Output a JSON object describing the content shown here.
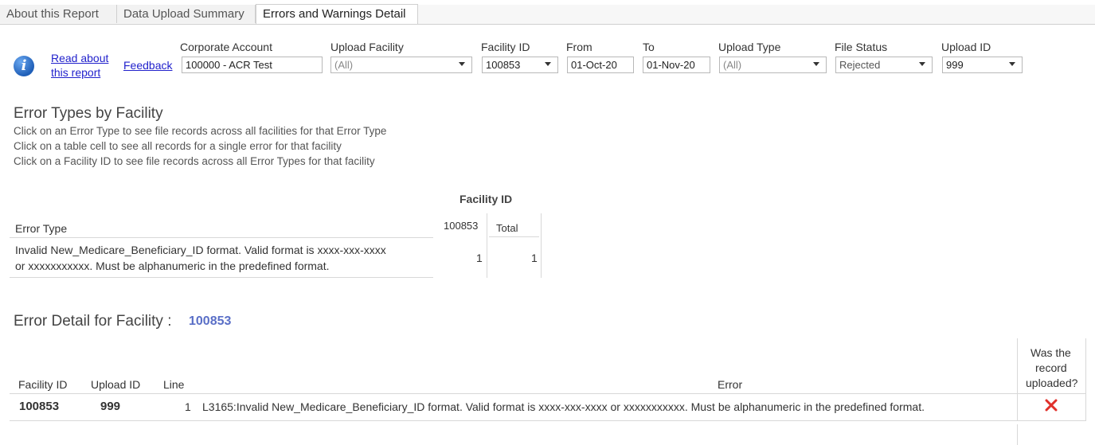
{
  "tabs": [
    "About this Report",
    "Data Upload Summary",
    "Errors and Warnings Detail"
  ],
  "links": {
    "read_about_line1": "Read about",
    "read_about_line2": "this report",
    "feedback": "Feedback"
  },
  "filters": {
    "corporate_account": {
      "label": "Corporate Account",
      "value": "100000 - ACR Test"
    },
    "upload_facility": {
      "label": "Upload Facility",
      "value": "(All)"
    },
    "facility_id": {
      "label": "Facility ID",
      "value": "100853"
    },
    "from": {
      "label": "From",
      "value": "01-Oct-20"
    },
    "to": {
      "label": "To",
      "value": "01-Nov-20"
    },
    "upload_type": {
      "label": "Upload Type",
      "value": "(All)"
    },
    "file_status": {
      "label": "File Status",
      "value": "Rejected"
    },
    "upload_id": {
      "label": "Upload ID",
      "value": "999"
    }
  },
  "error_types": {
    "title": "Error Types by Facility",
    "instructions": [
      "Click on an Error Type to see file records across all facilities for that Error Type",
      "Click on a table cell to see all records for a single error for that facility",
      "Click on a Facility ID to see file records across all Error Types for that facility"
    ],
    "column_group": "Facility ID",
    "row_header": "Error Type",
    "columns": [
      "100853",
      "Total"
    ],
    "row": {
      "error_line1": "Invalid New_Medicare_Beneficiary_ID format. Valid format is xxxx-xxx-xxxx",
      "error_line2": "or xxxxxxxxxxx. Must be alphanumeric in the predefined format.",
      "values": [
        "1",
        "1"
      ]
    }
  },
  "error_detail": {
    "title": "Error Detail for Facility :",
    "facility": "100853",
    "headers": {
      "facility_id": "Facility ID",
      "upload_id": "Upload ID",
      "line": "Line",
      "error": "Error",
      "uploaded_l1": "Was the",
      "uploaded_l2": "record",
      "uploaded_l3": "uploaded?"
    },
    "row": {
      "facility_id": "100853",
      "upload_id": "999",
      "line": "1",
      "error": "L3165:Invalid New_Medicare_Beneficiary_ID format. Valid format is xxxx-xxx-xxxx or xxxxxxxxxxx. Must be alphanumeric in the predefined format.",
      "uploaded_icon": "red-x-icon"
    }
  },
  "colors": {
    "accent_blue": "#5a6fc7",
    "reject_red": "#e0302a"
  }
}
